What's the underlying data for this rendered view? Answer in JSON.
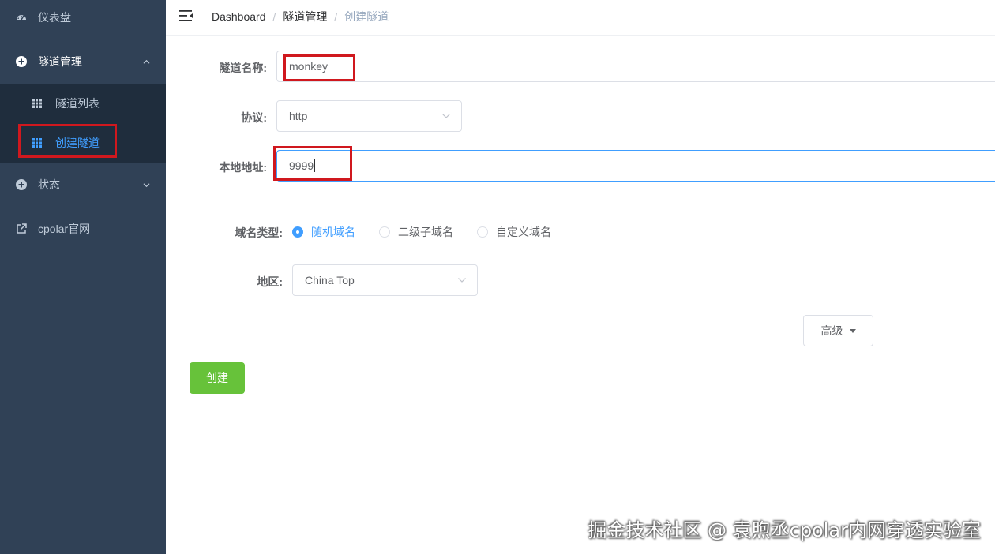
{
  "sidebar": {
    "items": [
      {
        "label": "仪表盘",
        "icon": "dashboard-icon"
      },
      {
        "label": "隧道管理",
        "icon": "circle-plus-icon",
        "expanded": true
      },
      {
        "label": "状态",
        "icon": "circle-plus-icon",
        "expanded": false
      },
      {
        "label": "cpolar官网",
        "icon": "external-link-icon"
      }
    ],
    "submenu": [
      {
        "label": "隧道列表",
        "icon": "table-icon"
      },
      {
        "label": "创建隧道",
        "icon": "table-icon",
        "active": true
      }
    ]
  },
  "header": {
    "breadcrumb": [
      "Dashboard",
      "隧道管理",
      "创建隧道"
    ],
    "separator": "/"
  },
  "form": {
    "name_label": "隧道名称:",
    "name_value": "monkey",
    "protocol_label": "协议:",
    "protocol_value": "http",
    "local_label": "本地地址:",
    "local_value": "9999",
    "domain_type_label": "域名类型:",
    "domain_types": [
      "随机域名",
      "二级子域名",
      "自定义域名"
    ],
    "domain_type_selected": "随机域名",
    "region_label": "地区:",
    "region_value": "China Top",
    "advanced_label": "高级",
    "create_label": "创建"
  },
  "watermark": "掘金技术社区 @ 袁煦丞cpolar内网穿透实验室",
  "colors": {
    "sidebar_bg": "#304156",
    "submenu_bg": "#1f2d3d",
    "accent": "#409eff",
    "success": "#67c23a",
    "highlight_box": "#d0181e"
  }
}
